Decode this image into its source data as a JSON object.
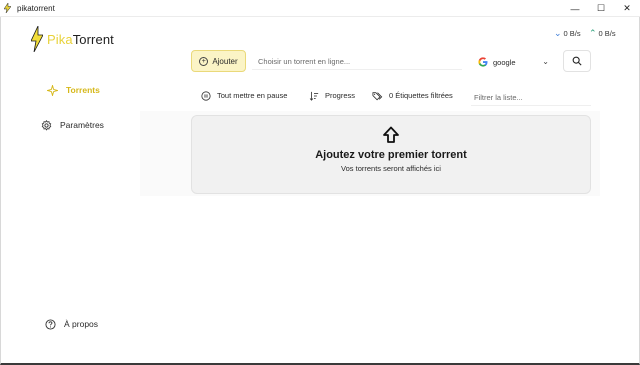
{
  "window": {
    "title": "pikatorrent",
    "controls": {
      "minimize": "—",
      "maximize": "☐",
      "close": "✕"
    }
  },
  "brand": {
    "part1": "Pika",
    "part2": "Torrent"
  },
  "sidebar": {
    "items": [
      {
        "label": "Torrents",
        "icon": "sparkle-icon",
        "active": true
      },
      {
        "label": "Paramètres",
        "icon": "gear-icon",
        "active": false
      }
    ],
    "about": {
      "label": "À propos",
      "icon": "help-circle-icon"
    }
  },
  "speeds": {
    "download": "0 B/s",
    "upload": "0 B/s",
    "download_color": "#3b7bd8",
    "upload_color": "#2aa07a"
  },
  "toolbar": {
    "add_label": "Ajouter",
    "search_placeholder": "Choisir un torrent en ligne...",
    "engine": "google"
  },
  "filters": {
    "pause_all": "Tout mettre en pause",
    "sort": "Progress",
    "labels": "0 Étiquettes filtrées",
    "filter_placeholder": "Filtrer la liste..."
  },
  "empty_state": {
    "title": "Ajoutez votre premier torrent",
    "subtitle": "Vos torrents seront affichés ici"
  },
  "colors": {
    "accent": "#e8d23a",
    "accent_bg": "#fbf4c6"
  }
}
